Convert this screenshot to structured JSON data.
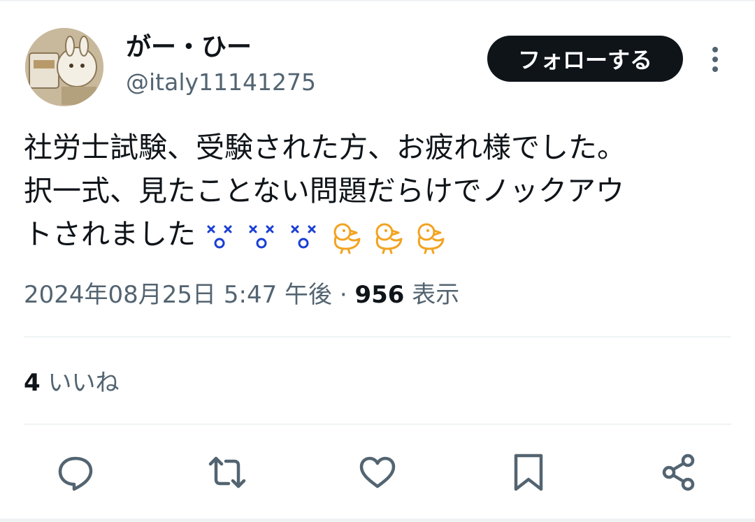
{
  "user": {
    "display_name": "がー・ひー",
    "handle": "@italy11141275",
    "avatar_icon": "user-avatar"
  },
  "follow_button": {
    "label": "フォローする"
  },
  "more_icon": "more-vertical-icon",
  "tweet": {
    "lines": [
      "社労士試験、受験された方、お疲れ様でした。",
      "択一式、見たことない問題だらけでノックアウ",
      "トされました"
    ],
    "emojis": [
      "dizzy-face-emoji",
      "dizzy-face-emoji",
      "dizzy-face-emoji",
      "baby-chick-emoji",
      "baby-chick-emoji",
      "baby-chick-emoji"
    ]
  },
  "meta": {
    "timestamp": "2024年08月25日 5:47 午後",
    "separator": "·",
    "views_count": "956",
    "views_label": "表示"
  },
  "likes": {
    "count": "4",
    "label": "いいね"
  },
  "actions": [
    "reply-icon",
    "retweet-icon",
    "like-icon",
    "bookmark-icon",
    "share-icon"
  ],
  "colors": {
    "text_primary": "#0f1419",
    "text_secondary": "#536471",
    "divider": "#eff3f4",
    "dizzy_emoji": "#1a3fd4",
    "chick_emoji": "#f2a321",
    "follow_button_bg": "#0f1419",
    "follow_button_fg": "#ffffff"
  }
}
